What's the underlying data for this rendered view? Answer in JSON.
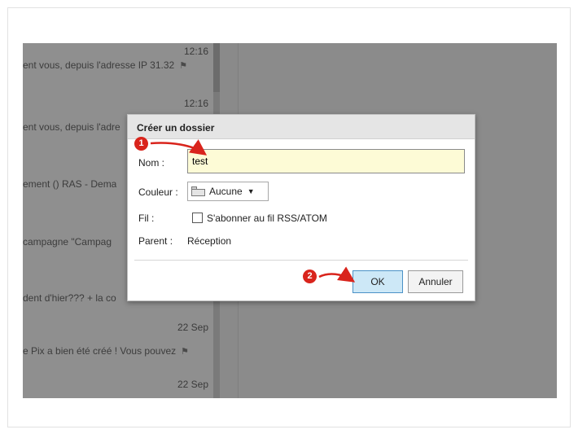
{
  "background_list": {
    "rows": [
      {
        "time": "12:16",
        "text": ""
      },
      {
        "time": "",
        "text": "ent vous, depuis l'adresse IP 31.32"
      },
      {
        "time": "12:16",
        "text": ""
      },
      {
        "time": "",
        "text": "ent vous, depuis l'adre"
      },
      {
        "time": "",
        "text": "ement () RAS - Dema"
      },
      {
        "time": "",
        "text": "campagne \"Campag"
      },
      {
        "time": "",
        "text": "dent d'hier??? + la co"
      },
      {
        "time": "22 Sep",
        "text": ""
      },
      {
        "time": "",
        "text": "e Pix a bien été créé ! Vous pouvez"
      },
      {
        "time": "22 Sep",
        "text": ""
      }
    ]
  },
  "dialog": {
    "title": "Créer un dossier",
    "name_label": "Nom :",
    "name_value": "test",
    "color_label": "Couleur :",
    "color_value": "Aucune",
    "feed_label": "Fil :",
    "feed_checkbox_label": "S'abonner au fil RSS/ATOM",
    "feed_checked": false,
    "parent_label": "Parent :",
    "parent_value": "Réception",
    "ok_label": "OK",
    "cancel_label": "Annuler"
  },
  "annotations": {
    "step1": "1",
    "step2": "2",
    "color": "#d9241c"
  },
  "icons": {
    "flag": "flag-icon",
    "folder": "folder-icon",
    "caret": "caret-down-icon"
  }
}
